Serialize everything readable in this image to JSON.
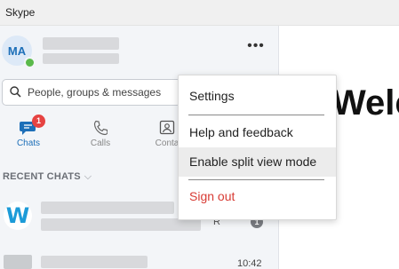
{
  "window": {
    "title": "Skype"
  },
  "profile": {
    "initials": "MA"
  },
  "search": {
    "placeholder": "People, groups & messages"
  },
  "tabs": [
    {
      "label": "Chats",
      "badge": "1"
    },
    {
      "label": "Calls"
    },
    {
      "label": "Conta"
    }
  ],
  "recent_chats": {
    "header": "RECENT CHATS",
    "items": [
      {
        "logo_letter": "W",
        "unread": "1",
        "fragment": "R"
      },
      {
        "time": "10:42"
      }
    ]
  },
  "main": {
    "welcome_text": "Welc"
  },
  "menu": {
    "items": [
      {
        "label": "Settings"
      },
      {
        "label": "Help and feedback"
      },
      {
        "label": "Enable split view mode"
      },
      {
        "label": "Sign out"
      }
    ]
  },
  "colors": {
    "accent": "#1d6fb8",
    "badge": "#e64342",
    "signout": "#d83b34",
    "presence": "#5ab94b"
  }
}
